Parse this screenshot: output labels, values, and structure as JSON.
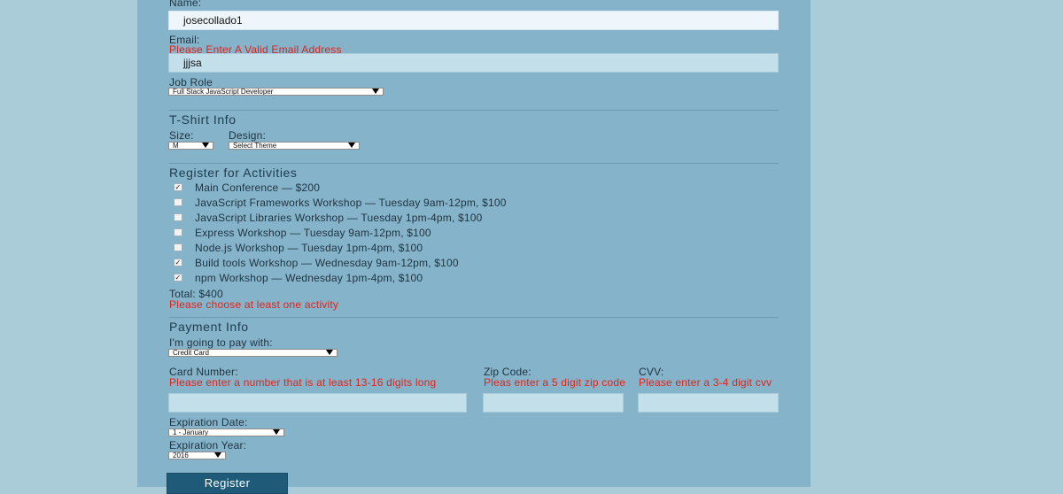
{
  "form": {
    "name_label": "Name:",
    "name_value": "josecollado1",
    "email_label": "Email:",
    "email_error": "Please Enter A Valid Email Address",
    "email_value": "jjjsa",
    "job_role_label": "Job Role",
    "job_role_selected": "Full Stack JavaScript Developer"
  },
  "tshirt": {
    "title": "T-Shirt Info",
    "size_label": "Size:",
    "size_selected": "M",
    "design_label": "Design:",
    "design_selected": "Select Theme"
  },
  "activities": {
    "title": "Register for Activities",
    "items": [
      {
        "label": "Main Conference — $200",
        "checked": true
      },
      {
        "label": "JavaScript Frameworks Workshop — Tuesday 9am-12pm, $100",
        "checked": false
      },
      {
        "label": "JavaScript Libraries Workshop — Tuesday 1pm-4pm, $100",
        "checked": false
      },
      {
        "label": "Express Workshop — Tuesday 9am-12pm, $100",
        "checked": false
      },
      {
        "label": "Node.js Workshop — Tuesday 1pm-4pm, $100",
        "checked": false
      },
      {
        "label": "Build tools Workshop — Wednesday 9am-12pm, $100",
        "checked": true
      },
      {
        "label": "npm Workshop — Wednesday 1pm-4pm, $100",
        "checked": true
      }
    ],
    "total": "Total: $400",
    "error": "Please choose at least one activity"
  },
  "payment": {
    "title": "Payment Info",
    "pay_with_label": "I'm going to pay with:",
    "pay_with_selected": "Credit Card",
    "card_label": "Card Number:",
    "card_error": "Please enter a number that is at least 13-16 digits long",
    "zip_label": "Zip Code:",
    "zip_error": "Pleas enter a 5 digit zip code",
    "cvv_label": "CVV:",
    "cvv_error": "Please enter a 3-4 digit cvv",
    "exp_date_label": "Expiration Date:",
    "exp_date_selected": "1 - January",
    "exp_year_label": "Expiration Year:",
    "exp_year_selected": "2016"
  },
  "submit_label": "Register",
  "colors": {
    "error": "#e0241b",
    "button": "#1f5a78",
    "panel": "#85b3c9",
    "background": "#a9ccd8"
  }
}
